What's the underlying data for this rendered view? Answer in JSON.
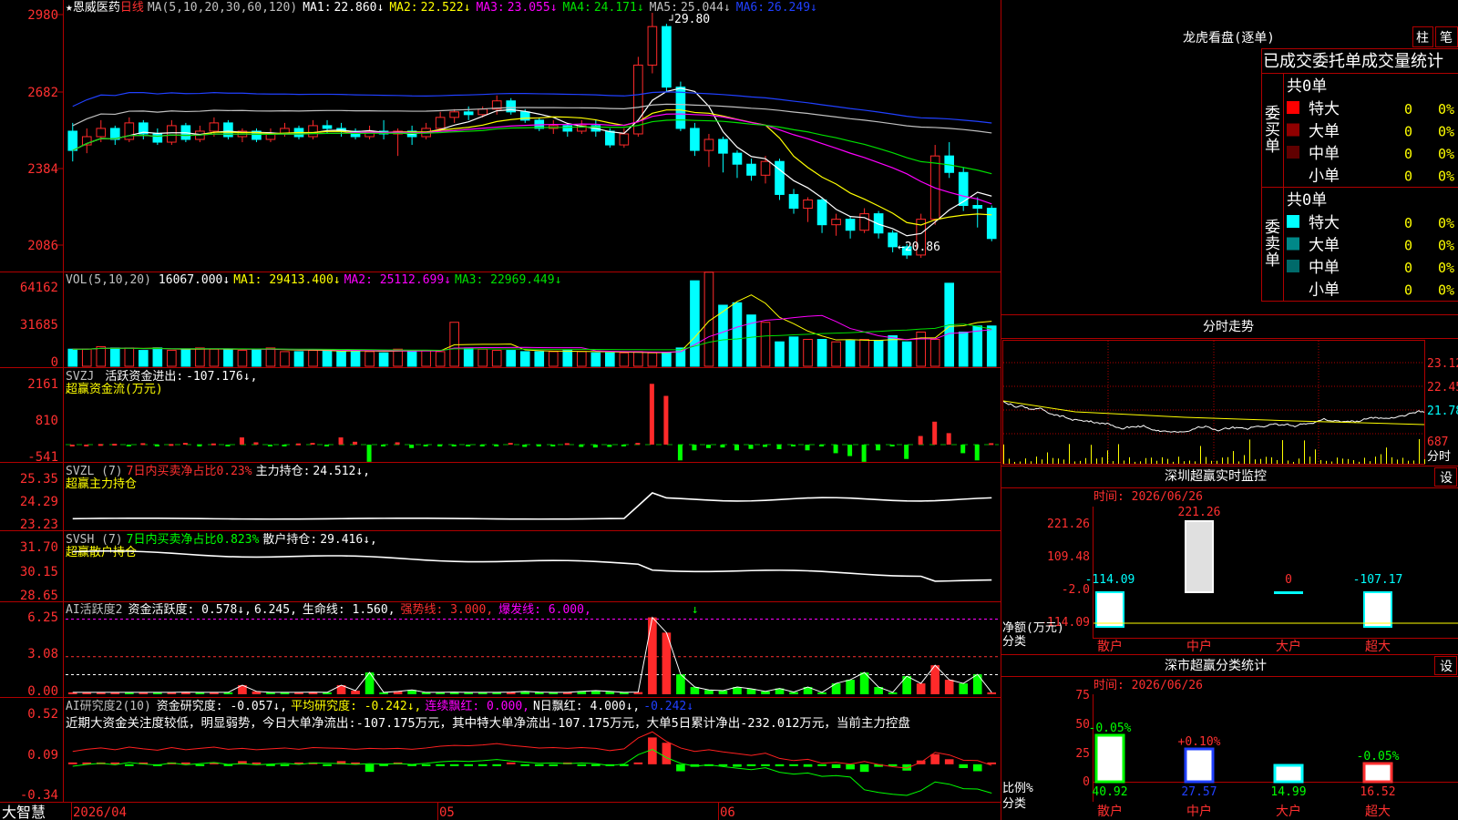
{
  "colors": {
    "up": "#ff2a2a",
    "down": "#00ffff",
    "ma1": "#ffffff",
    "ma2": "#ffff00",
    "ma3": "#ff00ff",
    "ma4": "#00e000",
    "ma5": "#c0c0c0",
    "ma6": "#2040ff",
    "grid": "#b00000",
    "red_text": "#ff3030",
    "yellow": "#ffff00",
    "cyan": "#00ffff",
    "green": "#00ff00"
  },
  "header": {
    "stock": "★恩威医药",
    "period": "日线",
    "ma_param": "MA(5,10,20,30,60,120)",
    "ma": [
      {
        "label": "MA1:",
        "value": "22.860↓"
      },
      {
        "label": "MA2:",
        "value": "22.522↓"
      },
      {
        "label": "MA3:",
        "value": "23.055↓"
      },
      {
        "label": "MA4:",
        "value": "24.171↓"
      },
      {
        "label": "MA5:",
        "value": "25.044↓"
      },
      {
        "label": "MA6:",
        "value": "26.249↓"
      }
    ]
  },
  "annotations": {
    "high": "29.80",
    "low": "←20.86"
  },
  "axes": {
    "price": [
      "2980",
      "2682",
      "2384",
      "2086"
    ],
    "vol": [
      "64162",
      "31685",
      "0"
    ],
    "svzj": [
      "2161",
      "810",
      "-541"
    ],
    "svzl": [
      "25.35",
      "24.29",
      "23.23"
    ],
    "svsh": [
      "31.70",
      "30.15",
      "28.65"
    ],
    "ai": [
      "6.25",
      "3.08",
      "0.00"
    ],
    "research": [
      "0.52",
      "0.09",
      "-0.34"
    ],
    "dates": [
      "2026/04",
      "05",
      "06"
    ]
  },
  "vol_header": {
    "title": "VOL(5,10,20)",
    "value": "16067.000↓",
    "ma1": "MA1: 29413.400↓",
    "ma2": "MA2: 25112.699↓",
    "ma3": "MA3: 22969.449↓"
  },
  "svzj_header": {
    "title": "SVZJ",
    "label": "活跃资金进出:",
    "value": "-107.176↓,",
    "sub": "超赢资金流(万元)"
  },
  "svzl_header": {
    "title": "SVZL (7)",
    "pct": "7日内买卖净占比0.23%",
    "label": "主力持仓:",
    "value": "24.512↓,",
    "sub": "超赢主力持仓"
  },
  "svsh_header": {
    "title": "SVSH (7)",
    "pct": "7日内买卖净占比0.823%",
    "label": "散户持仓:",
    "value": "29.416↓,",
    "sub": "超赢散户持仓"
  },
  "ai_header": {
    "title": "AI活跃度2",
    "a": "资金活跃度: 0.578↓,",
    "b": "6.245,",
    "c": "生命线: 1.560,",
    "d": "强势线: 3.000,",
    "e": "爆发线: 6.000,",
    "f": "↓"
  },
  "research_header": {
    "title": "AI研究度2(10)",
    "a": "资金研究度: -0.057↓,",
    "b": "平均研究度: -0.242↓,",
    "c": "连续飘红: 0.000,",
    "d": "N日飘红: 4.000↓,",
    "e": "-0.242↓",
    "text": "近期大资金关注度较低，明显弱势，今日大单净流出:-107.175万元，其中特大单净流出-107.175万元，大单5日累计净出-232.012万元，当前主力控盘"
  },
  "brand": "大智慧",
  "dragon": {
    "title": "龙虎看盘(逐单)",
    "btn1": "柱",
    "btn2": "笔",
    "subtitle": "已成交委托单成交量统计",
    "buy": {
      "side": [
        "委",
        "买",
        "单"
      ],
      "total": "共0单",
      "rows": [
        {
          "name": "特大",
          "n": "0",
          "p": "0%",
          "color": "#ff0000"
        },
        {
          "name": "大单",
          "n": "0",
          "p": "0%",
          "color": "#900000"
        },
        {
          "name": "中单",
          "n": "0",
          "p": "0%",
          "color": "#600000"
        },
        {
          "name": "小单",
          "n": "0",
          "p": "0%",
          "color": "#000000"
        }
      ]
    },
    "sell": {
      "side": [
        "委",
        "卖",
        "单"
      ],
      "total": "共0单",
      "rows": [
        {
          "name": "特大",
          "n": "0",
          "p": "0%",
          "color": "#00ffff"
        },
        {
          "name": "大单",
          "n": "0",
          "p": "0%",
          "color": "#008888"
        },
        {
          "name": "中单",
          "n": "0",
          "p": "0%",
          "color": "#006a6a"
        },
        {
          "name": "小单",
          "n": "0",
          "p": "0%",
          "color": "#000000"
        }
      ]
    }
  },
  "intraday": {
    "title": "分时走势",
    "y": [
      "23.12",
      "22.45",
      "21.78",
      "687"
    ],
    "unit": "分时"
  },
  "sz_monitor": {
    "title": "深圳超赢实时监控",
    "btn": "设",
    "date": "时间: 2026/06/26",
    "y": [
      "221.26",
      "109.48",
      "-2.0",
      "-114.09"
    ],
    "ylabel": "净额(万元)",
    "xlabel": "分类",
    "labels": [
      "散户",
      "中户",
      "大户",
      "超大"
    ],
    "values_text": [
      "-114.09",
      "221.26",
      "0",
      "-107.17"
    ]
  },
  "sz_stats": {
    "title": "深市超赢分类统计",
    "btn": "设",
    "date": "时间: 2026/06/26",
    "y": [
      "75",
      "50",
      "25",
      "0"
    ],
    "ylabel": "比例%",
    "xlabel": "分类",
    "labels": [
      "散户",
      "中户",
      "大户",
      "超大"
    ],
    "pct": [
      "-0.05%",
      "+0.10%",
      "",
      "-0.05%"
    ],
    "values_text": [
      "40.92",
      "27.57",
      "14.99",
      "16.52"
    ]
  },
  "chart_data": [
    {
      "type": "candlestick",
      "title": "恩威医药 日线",
      "y_range": [
        20.6,
        30.0
      ],
      "ohlc": [
        [
          25.5,
          24.8,
          25.8,
          24.4
        ],
        [
          25.0,
          25.3,
          25.6,
          24.7
        ],
        [
          25.3,
          25.6,
          25.9,
          25.1
        ],
        [
          25.6,
          25.2,
          25.7,
          25.0
        ],
        [
          25.2,
          25.8,
          26.0,
          25.1
        ],
        [
          25.8,
          25.4,
          25.9,
          25.2
        ],
        [
          25.4,
          25.1,
          25.6,
          25.0
        ],
        [
          25.1,
          25.7,
          25.9,
          25.0
        ],
        [
          25.7,
          25.2,
          25.8,
          25.1
        ],
        [
          25.2,
          25.5,
          25.7,
          25.1
        ],
        [
          25.5,
          25.8,
          26.0,
          25.3
        ],
        [
          25.8,
          25.3,
          25.9,
          25.2
        ],
        [
          25.3,
          25.5,
          25.6,
          25.1
        ],
        [
          25.5,
          25.2,
          25.6,
          25.1
        ],
        [
          25.2,
          25.4,
          25.6,
          25.1
        ],
        [
          25.4,
          25.6,
          25.8,
          25.3
        ],
        [
          25.6,
          25.3,
          25.7,
          25.2
        ],
        [
          25.3,
          25.7,
          25.9,
          25.2
        ],
        [
          25.7,
          25.6,
          25.9,
          25.4
        ],
        [
          25.6,
          25.5,
          25.8,
          25.3
        ],
        [
          25.5,
          25.3,
          25.6,
          25.2
        ],
        [
          25.3,
          25.5,
          25.7,
          25.2
        ],
        [
          25.5,
          25.4,
          25.9,
          25.2
        ],
        [
          25.4,
          25.5,
          25.6,
          24.6
        ],
        [
          25.5,
          25.3,
          25.7,
          25.0
        ],
        [
          25.3,
          25.6,
          25.8,
          25.2
        ],
        [
          25.6,
          26.0,
          26.2,
          25.5
        ],
        [
          26.0,
          26.2,
          26.3,
          25.8
        ],
        [
          26.2,
          26.1,
          26.4,
          25.9
        ],
        [
          26.1,
          26.3,
          26.4,
          26.0
        ],
        [
          26.3,
          26.6,
          26.8,
          26.1
        ],
        [
          26.6,
          26.2,
          26.7,
          26.1
        ],
        [
          26.2,
          25.9,
          26.3,
          25.8
        ],
        [
          25.9,
          25.6,
          26.0,
          25.5
        ],
        [
          25.6,
          25.7,
          25.9,
          25.4
        ],
        [
          25.7,
          25.5,
          25.8,
          25.3
        ],
        [
          25.5,
          25.7,
          25.9,
          25.4
        ],
        [
          25.7,
          25.5,
          25.9,
          25.3
        ],
        [
          25.5,
          25.0,
          25.6,
          24.9
        ],
        [
          25.0,
          25.4,
          25.6,
          24.9
        ],
        [
          25.4,
          27.9,
          28.2,
          25.3
        ],
        [
          27.9,
          29.3,
          29.8,
          27.6
        ],
        [
          29.3,
          27.1,
          29.4,
          26.9
        ],
        [
          27.1,
          25.6,
          27.3,
          25.5
        ],
        [
          25.6,
          24.8,
          25.8,
          24.6
        ],
        [
          24.8,
          25.2,
          25.4,
          24.2
        ],
        [
          25.2,
          24.7,
          25.3,
          24.0
        ],
        [
          24.7,
          24.3,
          24.8,
          23.8
        ],
        [
          24.3,
          23.9,
          24.5,
          23.7
        ],
        [
          23.9,
          24.4,
          24.6,
          23.6
        ],
        [
          24.4,
          23.2,
          24.5,
          23.0
        ],
        [
          23.2,
          22.7,
          23.4,
          22.5
        ],
        [
          22.7,
          23.0,
          23.1,
          22.2
        ],
        [
          23.0,
          22.1,
          23.1,
          21.8
        ],
        [
          22.1,
          22.3,
          22.5,
          21.7
        ],
        [
          22.3,
          21.9,
          22.4,
          21.6
        ],
        [
          21.9,
          22.5,
          22.7,
          21.8
        ],
        [
          22.5,
          21.8,
          22.6,
          21.6
        ],
        [
          21.8,
          21.3,
          21.9,
          21.1
        ],
        [
          21.3,
          21.0,
          21.4,
          20.86
        ],
        [
          21.0,
          22.3,
          22.5,
          20.9
        ],
        [
          22.3,
          24.6,
          25.0,
          22.1
        ],
        [
          24.6,
          24.0,
          25.1,
          23.8
        ],
        [
          24.0,
          22.8,
          24.2,
          22.6
        ],
        [
          22.8,
          22.7,
          23.1,
          22.0
        ],
        [
          22.7,
          21.6,
          22.8,
          21.5
        ]
      ],
      "series": [
        {
          "name": "MA1",
          "last": 22.86
        },
        {
          "name": "MA2",
          "last": 22.522
        },
        {
          "name": "MA3",
          "last": 23.055
        },
        {
          "name": "MA4",
          "last": 24.171
        },
        {
          "name": "MA5",
          "last": 25.044
        },
        {
          "name": "MA6",
          "last": 26.249
        }
      ]
    },
    {
      "type": "bar",
      "title": "VOL(5,10,20)",
      "y_range": [
        0,
        64162
      ],
      "values": [
        14000,
        14000,
        16000,
        15000,
        15000,
        13000,
        15000,
        13000,
        14000,
        15000,
        14000,
        14000,
        13000,
        14000,
        15000,
        12000,
        12000,
        13000,
        13000,
        12000,
        13000,
        12000,
        11000,
        14000,
        13000,
        13000,
        12000,
        36000,
        15000,
        14000,
        13000,
        13000,
        12000,
        12000,
        12000,
        13000,
        12000,
        11000,
        11000,
        11000,
        12000,
        11000,
        11000,
        15000,
        70000,
        78000,
        50000,
        52000,
        42000,
        36000,
        20000,
        24000,
        22000,
        22000,
        20000,
        21000,
        22000,
        21000,
        25000,
        20000,
        28000,
        22000,
        68000,
        28000,
        33000,
        33000,
        30000,
        20000
      ]
    },
    {
      "type": "bar",
      "title": "SVZJ 活跃资金进出",
      "y_range": [
        -541,
        2161
      ],
      "values": [
        0,
        0,
        20,
        30,
        -20,
        50,
        -30,
        20,
        60,
        -40,
        40,
        -30,
        250,
        80,
        -40,
        -20,
        40,
        60,
        -30,
        250,
        100,
        -600,
        -40,
        80,
        -120,
        -20,
        -50,
        -60,
        -40,
        -30,
        -40,
        60,
        -80,
        -60,
        -20,
        50,
        -80,
        -100,
        -80,
        -40,
        60,
        2120,
        1700,
        -550,
        -200,
        -120,
        -100,
        -200,
        -150,
        -80,
        -160,
        -60,
        -200,
        -40,
        -300,
        -400,
        -600,
        -200,
        -50,
        -500,
        300,
        800,
        400,
        -300,
        -550,
        50
      ]
    },
    {
      "type": "line",
      "title": "SVZL 主力持仓",
      "y_range": [
        23.23,
        25.35
      ],
      "last": 24.512
    },
    {
      "type": "line",
      "title": "SVSH 散户持仓",
      "y_range": [
        28.65,
        31.7
      ],
      "last": 29.416
    },
    {
      "type": "bar",
      "title": "AI活跃度2",
      "y_range": [
        0,
        6.25
      ],
      "lines": {
        "生命线": 1.56,
        "强势线": 3.0,
        "爆发线": 6.0
      }
    },
    {
      "type": "bar",
      "title": "AI研究度2(10)",
      "y_range": [
        -0.34,
        0.52
      ]
    }
  ]
}
